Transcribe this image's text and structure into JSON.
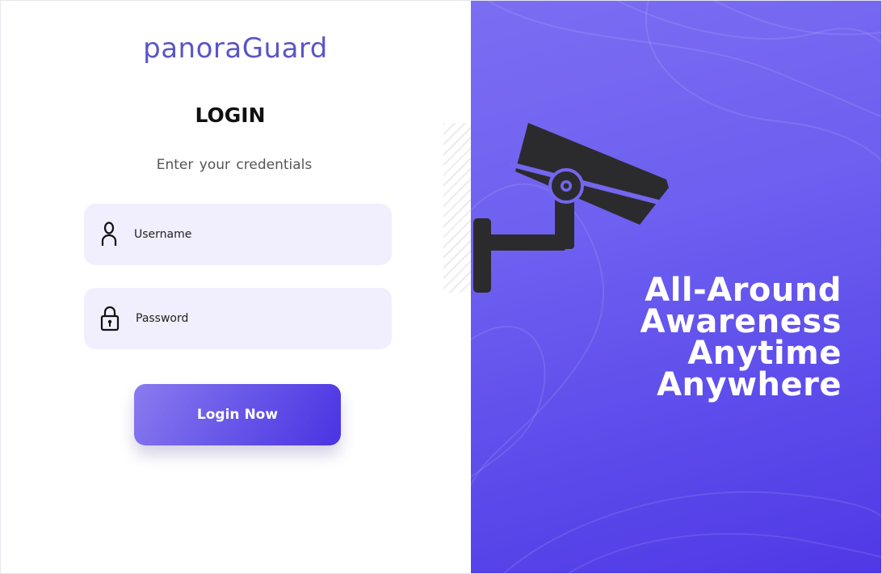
{
  "brand": {
    "name": "panoraGuard"
  },
  "login": {
    "title": "LOGIN",
    "subtitle": "Enter your  credentials",
    "username_label": "Username",
    "password_label": "Password",
    "submit_label": "Login Now"
  },
  "hero": {
    "tagline_lines": [
      "All-Around",
      "Awareness",
      "Anytime",
      "Anywhere"
    ]
  },
  "icons": {
    "username": "user-icon",
    "password": "lock-icon",
    "hero": "security-camera-icon"
  },
  "colors": {
    "brand": "#5a55c6",
    "accent": "#6a5ae9",
    "field_bg": "#f1effd",
    "hero_bg_start": "#7b6ef2",
    "hero_bg_end": "#5038e6"
  }
}
